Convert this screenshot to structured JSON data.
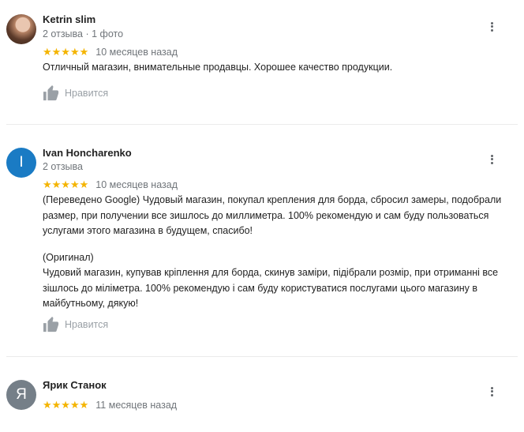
{
  "reviews": [
    {
      "author": "Ketrin slim",
      "meta": "2 отзыва · 1 фото",
      "stars": "★★★★★",
      "rating": 5,
      "date": "10 месяцев назад",
      "text": "Отличный магазин, внимательные продавцы. Хорошее качество продукции.",
      "like_label": "Нравится"
    },
    {
      "author": "Ivan Honcharenko",
      "avatar_letter": "I",
      "avatar_color": "#1a7bc4",
      "meta": "2 отзыва",
      "stars": "★★★★★",
      "rating": 5,
      "date": "10 месяцев назад",
      "text_translated": "(Переведено Google) Чудовый магазин, покупал крепления для борда, сбросил замеры, подобрали размер, при получении все зишлось до миллиметра. 100% рекомендую и сам буду пользоваться услугами этого магазина в будущем, спасибо!",
      "text_original_label": "(Оригинал)",
      "text_original": "Чудовий магазин, купував кріплення для борда, скинув заміри, підібрали розмір, при отриманні все зішлось до міліметра. 100% рекомендую і сам буду користуватися послугами цього магазину в майбутньому, дякую!",
      "like_label": "Нравится"
    },
    {
      "author": "Ярик Станок",
      "avatar_letter": "Я",
      "avatar_color": "#757f88",
      "stars": "★★★★★",
      "rating": 5,
      "date": "11 месяцев назад"
    }
  ],
  "colors": {
    "star": "#f4b400",
    "muted": "#70757a",
    "like": "#9aa0a6"
  },
  "icons": {
    "like": "thumbs-up-icon",
    "more": "more-vert-icon"
  }
}
